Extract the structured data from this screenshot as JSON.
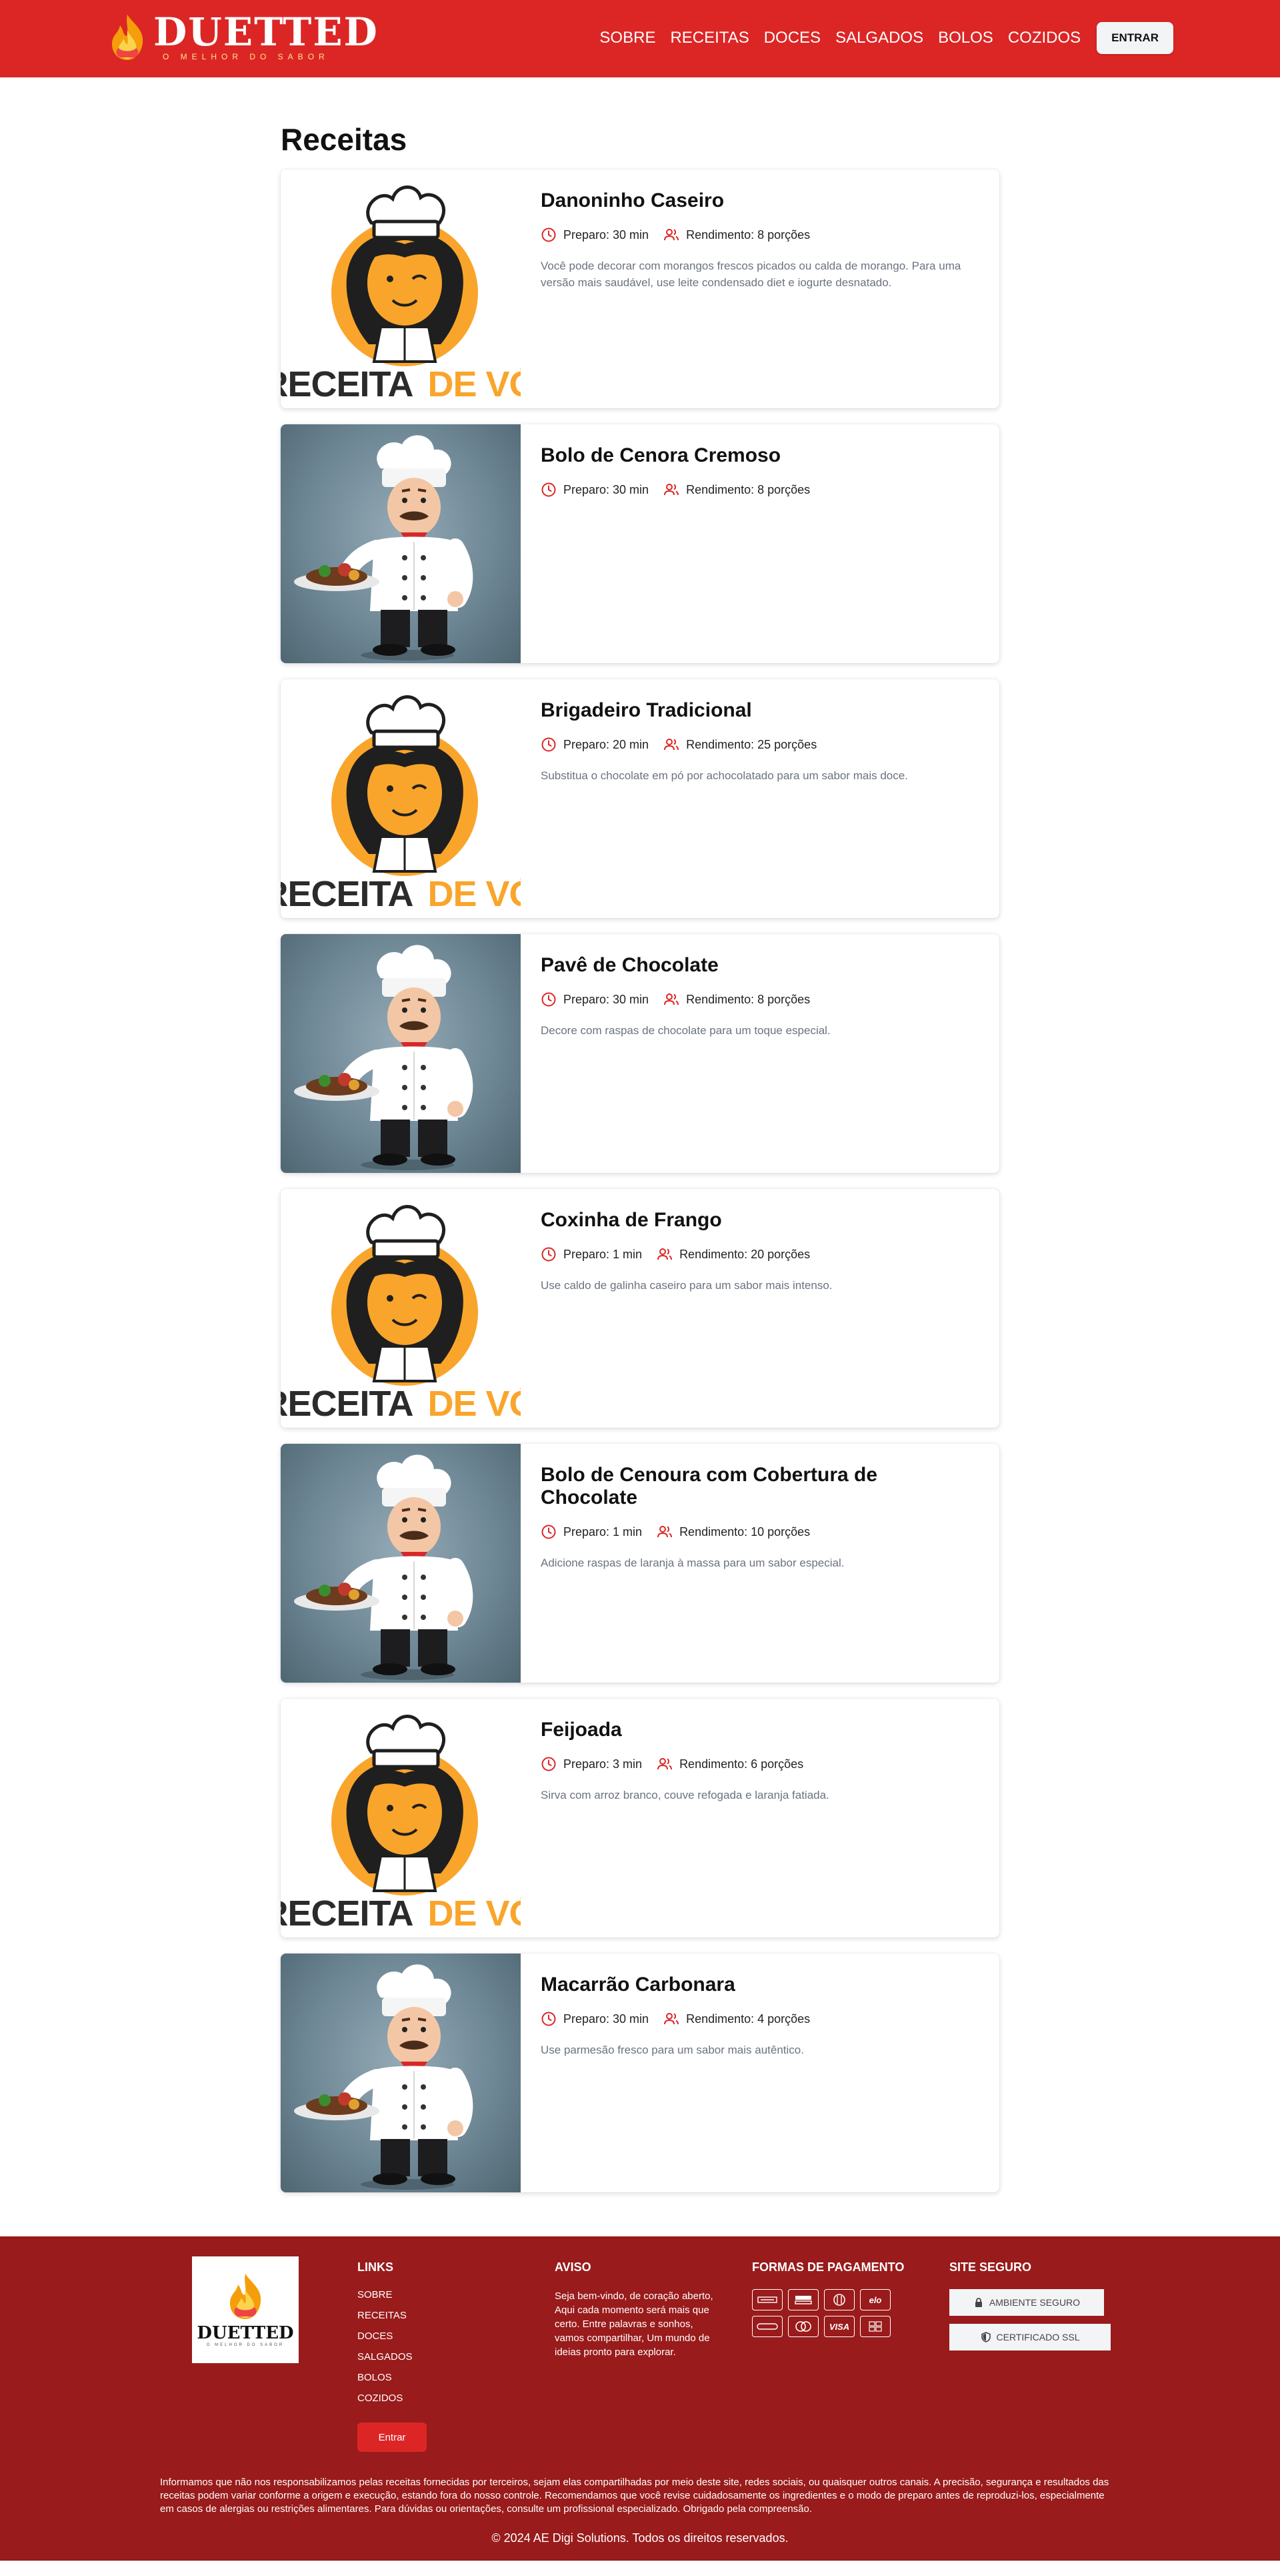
{
  "header": {
    "brand": "DUETTED",
    "tagline": "O MELHOR DO SABOR",
    "nav": [
      "SOBRE",
      "RECEITAS",
      "DOCES",
      "SALGADOS",
      "BOLOS",
      "COZIDOS"
    ],
    "login_label": "ENTRAR"
  },
  "main": {
    "title": "Receitas",
    "image_caption": [
      "RECEITA",
      "DE VÓ"
    ],
    "recipes": [
      {
        "title": "Danoninho Caseiro",
        "prep": "Preparo: 30 min",
        "yield": "Rendimento: 8 porções",
        "desc": "Você pode decorar com morangos frescos picados ou calda de morango. Para uma versão mais saudável, use leite condensado diet e iogurte desnatado.",
        "image": "vo"
      },
      {
        "title": "Bolo de Cenora Cremoso",
        "prep": "Preparo: 30 min",
        "yield": "Rendimento: 8 porções",
        "desc": "",
        "image": "chef"
      },
      {
        "title": "Brigadeiro Tradicional",
        "prep": "Preparo: 20 min",
        "yield": "Rendimento: 25 porções",
        "desc": "Substitua o chocolate em pó por achocolatado para um sabor mais doce.",
        "image": "vo"
      },
      {
        "title": "Pavê de Chocolate",
        "prep": "Preparo: 30 min",
        "yield": "Rendimento: 8 porções",
        "desc": "Decore com raspas de chocolate para um toque especial.",
        "image": "chef"
      },
      {
        "title": "Coxinha de Frango",
        "prep": "Preparo: 1 min",
        "yield": "Rendimento: 20 porções",
        "desc": "Use caldo de galinha caseiro para um sabor mais intenso.",
        "image": "vo"
      },
      {
        "title": "Bolo de Cenoura com Cobertura de Chocolate",
        "prep": "Preparo: 1 min",
        "yield": "Rendimento: 10 porções",
        "desc": "Adicione raspas de laranja à massa para um sabor especial.",
        "image": "chef"
      },
      {
        "title": "Feijoada",
        "prep": "Preparo: 3 min",
        "yield": "Rendimento: 6 porções",
        "desc": "Sirva com arroz branco, couve refogada e laranja fatiada.",
        "image": "vo"
      },
      {
        "title": "Macarrão Carbonara",
        "prep": "Preparo: 30 min",
        "yield": "Rendimento: 4 porções",
        "desc": "Use parmesão fresco para um sabor mais autêntico.",
        "image": "chef"
      }
    ]
  },
  "footer": {
    "logo_name": "DUETTED",
    "logo_tag": "O MELHOR DO SABOR",
    "links_title": "LINKS",
    "links": [
      "SOBRE",
      "RECEITAS",
      "DOCES",
      "SALGADOS",
      "BOLOS",
      "COZIDOS"
    ],
    "login_label": "Entrar",
    "aviso_title": "AVISO",
    "aviso_text": "Seja bem-vindo, de coração aberto, Aqui cada momento será mais que certo. Entre palavras e sonhos, vamos compartilhar, Um mundo de ideias pronto para explorar.",
    "payment_title": "FORMAS DE PAGAMENTO",
    "payment_methods": [
      "amex",
      "boleto",
      "diners",
      "elo",
      "hipercard",
      "mastercard",
      "VISA",
      "pix"
    ],
    "payment_labels": {
      "elo": "elo",
      "visa": "VISA"
    },
    "secure_title": "SITE SEGURO",
    "secure_badges": [
      "AMBIENTE SEGURO",
      "CERTIFICADO SSL"
    ],
    "disclaimer": "Informamos que não nos responsabilizamos pelas receitas fornecidas por terceiros, sejam elas compartilhadas por meio deste site, redes sociais, ou quaisquer outros canais. A precisão, segurança e resultados das receitas podem variar conforme a origem e execução, estando fora do nosso controle. Recomendamos que você revise cuidadosamente os ingredientes e o modo de preparo antes de reproduzi-los, especialmente em casos de alergias ou restrições alimentares. Para dúvidas ou orientações, consulte um profissional especializado. Obrigado pela compreensão.",
    "copyright": "© 2024 AE Digi Solutions. Todos os direitos reservados."
  },
  "colors": {
    "brand_red": "#dc2626",
    "footer_red": "#991b1b",
    "accent_orange": "#f9a52b"
  }
}
